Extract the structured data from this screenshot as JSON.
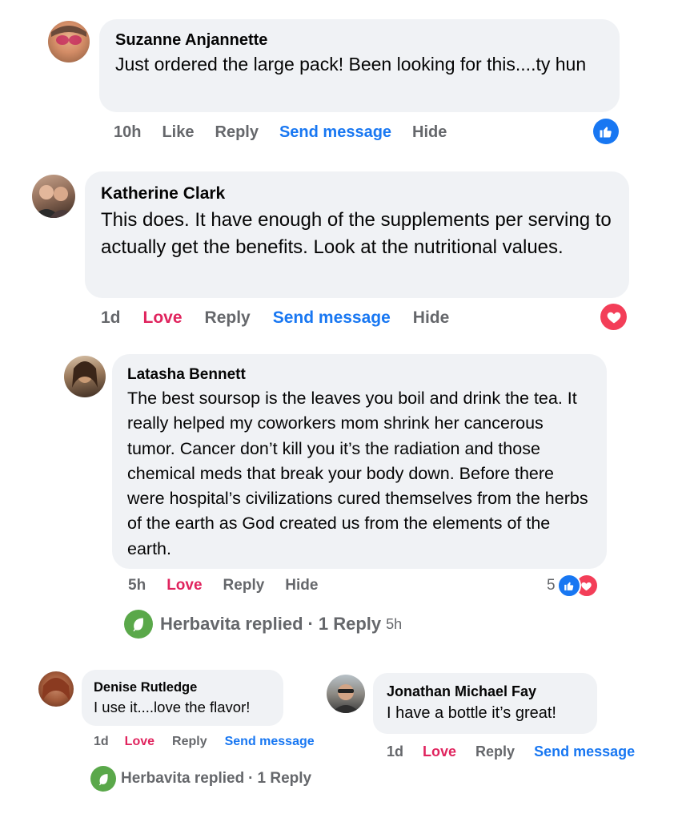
{
  "comments": [
    {
      "author": "Suzanne Anjannette",
      "text": "Just ordered the large pack! Been looking for this....ty hun",
      "time": "10h",
      "actions": [
        "Like",
        "Reply",
        "Send message",
        "Hide"
      ],
      "reaction": "like-icon"
    },
    {
      "author": "Katherine Clark",
      "text": "This does. It have enough of the supplements per serving to actually get the benefits. Look at the nutritional values.",
      "time": "1d",
      "actions": [
        "Love",
        "Reply",
        "Send message",
        "Hide"
      ],
      "reaction": "love-icon"
    },
    {
      "author": "Latasha Bennett",
      "text": "The best soursop is the leaves you boil and drink the tea. It really helped my coworkers mom shrink her cancerous tumor. Cancer don’t kill you it’s the radiation and those chemical meds that break your body down. Before there were hospital’s civilizations cured themselves from the herbs of the earth as God created us from the elements of the earth.",
      "time": "5h",
      "actions": [
        "Love",
        "Reply",
        "Hide"
      ],
      "reaction_count": "5",
      "replied": {
        "name": "Herbavita replied",
        "sep": "·",
        "count": "1 Reply",
        "time": "5h"
      }
    },
    {
      "author": "Denise Rutledge",
      "text": "I use it....love the flavor!",
      "time": "1d",
      "actions": [
        "Love",
        "Reply",
        "Send message"
      ],
      "replied": {
        "name": "Herbavita replied",
        "sep": "·",
        "count": "1 Reply"
      }
    },
    {
      "author": "Jonathan Michael Fay",
      "text": "I have a bottle it’s great!",
      "time": "1d",
      "actions": [
        "Love",
        "Reply",
        "Send message"
      ]
    }
  ],
  "colors": {
    "bubble": "#f0f2f5",
    "love": "#e0245e",
    "link": "#1877f2",
    "muted": "#65676b",
    "brand_leaf": "#5aa84a"
  }
}
